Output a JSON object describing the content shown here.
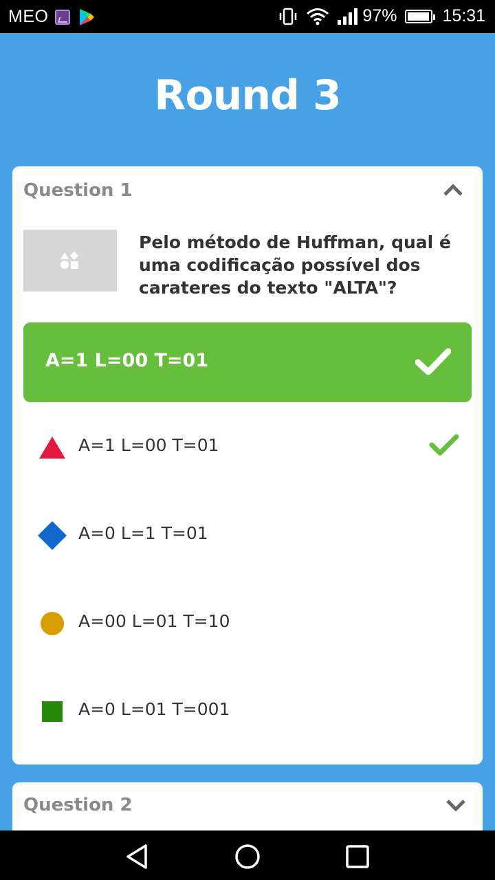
{
  "status_bar": {
    "carrier": "MEO",
    "battery": "97%",
    "time": "15:31"
  },
  "round_title": "Round 3",
  "question1": {
    "label": "Question 1",
    "text": "Pelo método de Huffman, qual é uma codificação possível dos carateres do texto \"ALTA\"?",
    "correct_answer": "A=1 L=00 T=01",
    "options": [
      {
        "text": "A=1 L=00 T=01",
        "shape": "triangle-icon",
        "color": "#e3173f",
        "correct": true
      },
      {
        "text": "A=0 L=1 T=01",
        "shape": "diamond-icon",
        "color": "#1368ce",
        "correct": false
      },
      {
        "text": "A=00 L=01 T=10",
        "shape": "circle-icon",
        "color": "#d89e00",
        "correct": false
      },
      {
        "text": "A=0 L=01 T=001",
        "shape": "square-icon",
        "color": "#26890c",
        "correct": false
      }
    ]
  },
  "question2": {
    "label": "Question 2"
  },
  "colors": {
    "background": "#46a2e5",
    "correct": "#66bf3c"
  }
}
